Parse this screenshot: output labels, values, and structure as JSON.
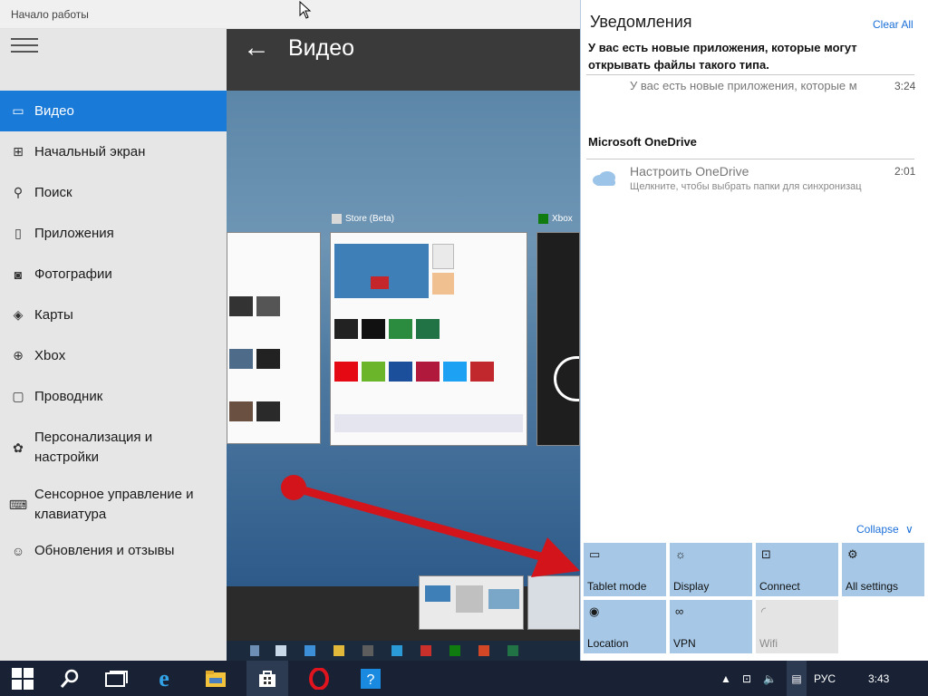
{
  "window": {
    "title": "Начало работы"
  },
  "sidebar": {
    "items": [
      {
        "label": "Видео",
        "icon": "video-icon",
        "glyph": "▭",
        "active": true
      },
      {
        "label": "Начальный экран",
        "icon": "start-screen-icon",
        "glyph": "⊞"
      },
      {
        "label": "Поиск",
        "icon": "search-icon",
        "glyph": "⚲"
      },
      {
        "label": "Приложения",
        "icon": "apps-icon",
        "glyph": "▯"
      },
      {
        "label": "Фотографии",
        "icon": "photos-icon",
        "glyph": "◙"
      },
      {
        "label": "Карты",
        "icon": "maps-icon",
        "glyph": "◈"
      },
      {
        "label": "Xbox",
        "icon": "xbox-icon",
        "glyph": "⊕"
      },
      {
        "label": "Проводник",
        "icon": "file-explorer-icon",
        "glyph": "▢"
      },
      {
        "label": "Персонализация и настройки",
        "icon": "personalization-icon",
        "glyph": "✿"
      },
      {
        "label": "Сенсорное управление и клавиатура",
        "icon": "keyboard-icon",
        "glyph": "⌨"
      },
      {
        "label": "Обновления и отзывы",
        "icon": "feedback-icon",
        "glyph": "☺"
      }
    ]
  },
  "content": {
    "title": "Видео",
    "thumbs": {
      "store_caption": "Store (Beta)",
      "xbox_caption": "Xbox"
    }
  },
  "action_center": {
    "title": "Уведомления",
    "clear_all": "Clear All",
    "groups": [
      {
        "header": "У вас есть новые приложения, которые могут открывать файлы такого типа.",
        "notifications": [
          {
            "text": "У вас есть новые приложения, которые м",
            "time": "3:24"
          }
        ]
      },
      {
        "header": "Microsoft OneDrive",
        "notifications": [
          {
            "text": "Настроить OneDrive",
            "sub": "Щелкните, чтобы выбрать папки для синхронизац",
            "time": "2:01"
          }
        ]
      }
    ],
    "collapse": "Collapse",
    "quick_actions": [
      {
        "label": "Tablet mode",
        "icon": "tablet-mode-icon",
        "glyph": "▭",
        "on": true
      },
      {
        "label": "Display",
        "icon": "display-icon",
        "glyph": "☼",
        "on": true
      },
      {
        "label": "Connect",
        "icon": "connect-icon",
        "glyph": "⊡",
        "on": true
      },
      {
        "label": "All settings",
        "icon": "settings-gear-icon",
        "glyph": "⚙",
        "on": true
      },
      {
        "label": "Location",
        "icon": "location-icon",
        "glyph": "◉",
        "on": true
      },
      {
        "label": "VPN",
        "icon": "vpn-icon",
        "glyph": "∞",
        "on": true
      },
      {
        "label": "Wifi",
        "icon": "wifi-icon",
        "glyph": "◜",
        "on": false
      }
    ]
  },
  "taskbar": {
    "language": "РУС",
    "time": "3:43"
  },
  "colors": {
    "accent": "#1a7ad8",
    "tile_on": "#a6c8e6",
    "taskbar": "#182234",
    "annotation_arrow": "#d3141b"
  }
}
